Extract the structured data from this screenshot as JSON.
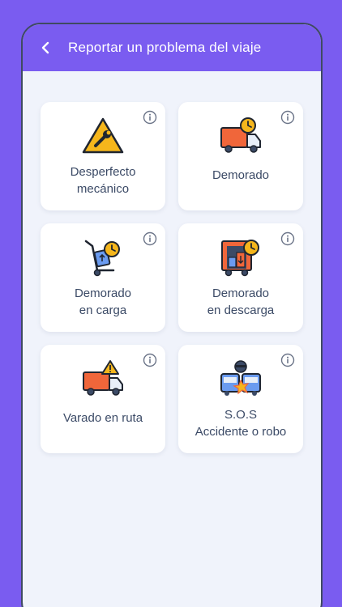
{
  "header": {
    "title": "Reportar un problema del viaje"
  },
  "options": [
    {
      "label": "Desperfecto\nmecánico",
      "icon": "mechanical-failure-icon"
    },
    {
      "label": "Demorado",
      "icon": "delayed-truck-icon"
    },
    {
      "label": "Demorado\nen carga",
      "icon": "delayed-loading-icon"
    },
    {
      "label": "Demorado\nen descarga",
      "icon": "delayed-unloading-icon"
    },
    {
      "label": "Varado en ruta",
      "icon": "stranded-truck-icon"
    },
    {
      "label": "S.O.S\nAccidente o robo",
      "icon": "sos-accident-icon"
    }
  ],
  "colors": {
    "accent": "#7a5cf0",
    "background": "#f0f3fb",
    "text": "#3b4a66",
    "truck_orange": "#f0663a",
    "clock_yellow": "#f5b61c"
  }
}
